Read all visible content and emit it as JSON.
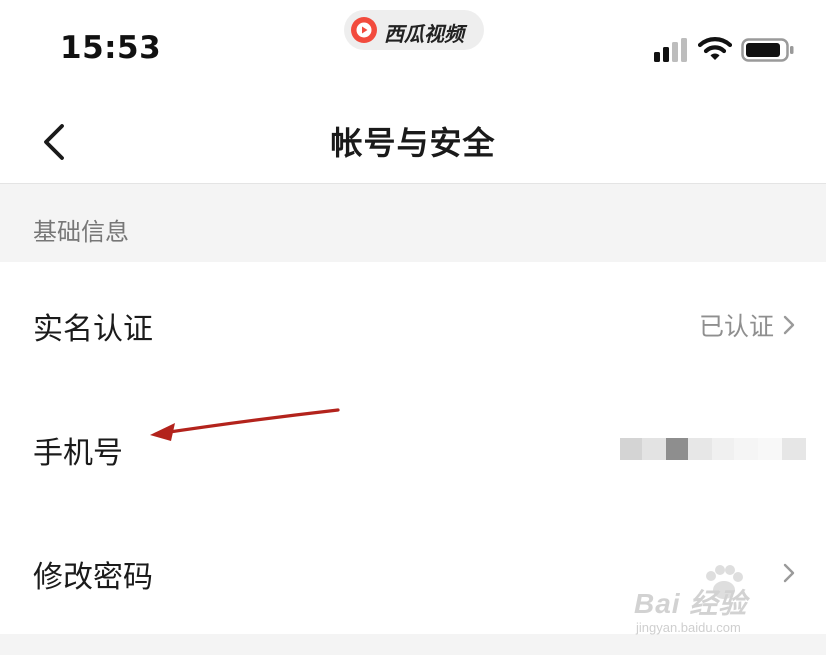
{
  "status_bar": {
    "time": "15:53",
    "app_pill": {
      "name": "西瓜视频",
      "logo_icon": "xigua-logo-icon",
      "brand_color": "#f24b3d"
    },
    "signal_icon": "signal-bars-icon",
    "wifi_icon": "wifi-icon",
    "battery_icon": "battery-icon"
  },
  "nav": {
    "back_icon": "chevron-left-icon",
    "title": "帐号与安全"
  },
  "sections": [
    {
      "header": "基础信息",
      "rows": [
        {
          "label": "实名认证",
          "value": "已认证",
          "has_chevron": true
        },
        {
          "label": "手机号",
          "value": "",
          "value_masked": true,
          "has_chevron": false
        },
        {
          "label": "修改密码",
          "value": "",
          "has_chevron": true
        }
      ]
    }
  ],
  "annotation": {
    "type": "arrow",
    "color": "#b3231c",
    "points_to": "手机号"
  },
  "watermark": {
    "main": "Bai 经验",
    "sub": "jingyan.baidu.com"
  },
  "colors": {
    "section_bg": "#f4f4f4",
    "primary_text": "#1b1b1b",
    "secondary_text": "#8f8f8f"
  }
}
